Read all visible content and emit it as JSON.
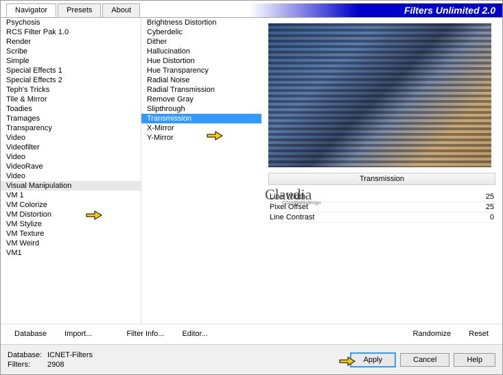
{
  "app_title": "Filters Unlimited 2.0",
  "tabs": [
    {
      "label": "Navigator",
      "active": true
    },
    {
      "label": "Presets",
      "active": false
    },
    {
      "label": "About",
      "active": false
    }
  ],
  "categories": [
    "Psychosis",
    "RCS Filter Pak 1.0",
    "Render",
    "Scribe",
    "Simple",
    "Special Effects 1",
    "Special Effects 2",
    "Teph's Tricks",
    "Tile & Mirror",
    "Toadies",
    "Tramages",
    "Transparency",
    "Video",
    "Videofilter",
    "Video",
    "VideoRave",
    "Video",
    "Visual Manipulation",
    "VM 1",
    "VM Colorize",
    "VM Distortion",
    "VM Stylize",
    "VM Texture",
    "VM Weird",
    "VM1"
  ],
  "selected_category_index": 17,
  "filters": [
    "Brightness Distortion",
    "Cyberdelic",
    "Dither",
    "Hallucination",
    "Hue Distortion",
    "Hue Transparency",
    "Radial Noise",
    "Radial Transmission",
    "Remove Gray",
    "Slipthrough",
    "Transmission",
    "X-Mirror",
    "Y-Mirror"
  ],
  "selected_filter_index": 10,
  "current_filter": "Transmission",
  "params": [
    {
      "name": "Line Width",
      "value": "25"
    },
    {
      "name": "Pixel Offset",
      "value": "25"
    },
    {
      "name": "Line Contrast",
      "value": "0"
    }
  ],
  "toolbar": {
    "database": "Database",
    "import": "Import...",
    "filter_info": "Filter Info...",
    "editor": "Editor...",
    "randomize": "Randomize",
    "reset": "Reset"
  },
  "footer": {
    "db_label": "Database:",
    "db_value": "ICNET-Filters",
    "filters_label": "Filters:",
    "filters_value": "2908",
    "apply": "Apply",
    "cancel": "Cancel",
    "help": "Help"
  },
  "watermark": "Claudia",
  "watermark_sub": "CGISPWebdesign"
}
